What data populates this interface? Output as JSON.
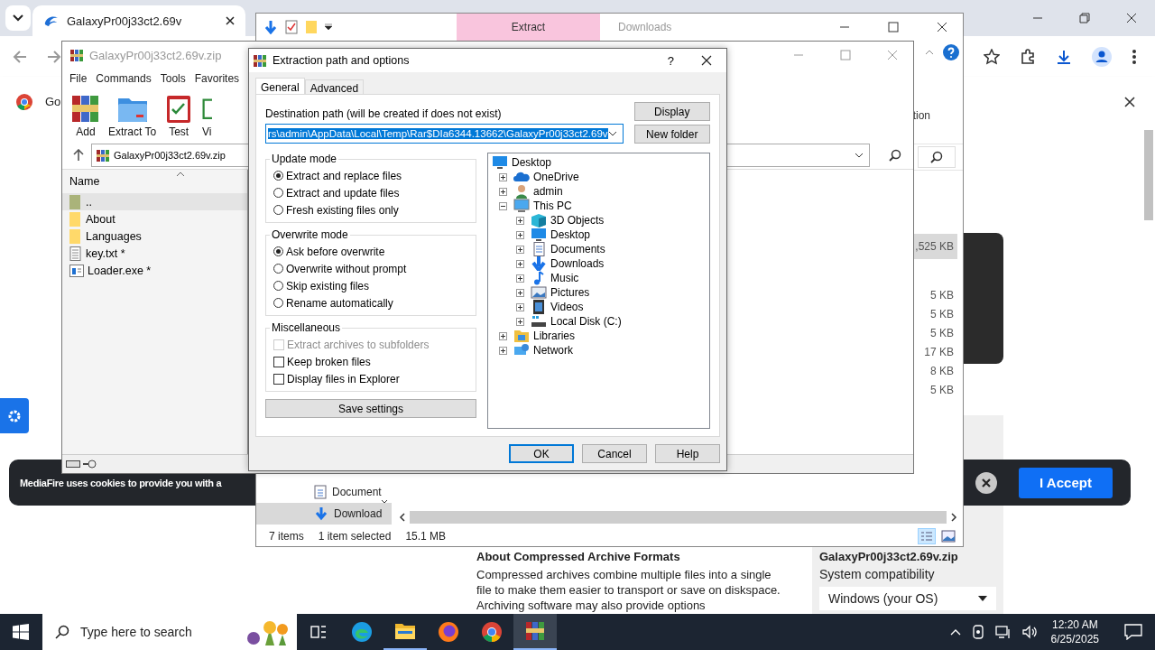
{
  "browser": {
    "tab_title": "GalaxyPr00j33ct2.69v",
    "bookmark_text": "Go"
  },
  "page": {
    "cookie_text": "MediaFire uses cookies to provide you with a",
    "accept_button": "I Accept",
    "heading": "About Compressed Archive Formats",
    "paragraph": "Compressed archives combine multiple files into a single file to make them easier to transport or save on diskspace. Archiving software may also provide options",
    "sidebar": {
      "file_name": "GalaxyPr00j33ct2.69v.zip",
      "label": "System compatibility",
      "os_select": "Windows (your OS)"
    }
  },
  "explorer": {
    "ribbon_tab": "Extract",
    "title": "Downloads",
    "ribbon_fragment": "tion",
    "sizes": [
      {
        "text": ",525 KB",
        "selected": true
      },
      {
        "text": "5 KB",
        "selected": false
      },
      {
        "text": "5 KB",
        "selected": false
      },
      {
        "text": "5 KB",
        "selected": false
      },
      {
        "text": "17 KB",
        "selected": false
      },
      {
        "text": "8 KB",
        "selected": false
      },
      {
        "text": "5 KB",
        "selected": false
      }
    ],
    "nav_items": [
      {
        "label": "Document",
        "kind": "documents",
        "selected": false
      },
      {
        "label": "Download",
        "kind": "downloads",
        "selected": true
      }
    ],
    "status_items": "7 items",
    "status_selected": "1 item selected",
    "status_size": "15.1 MB"
  },
  "winrar": {
    "title": "GalaxyPr00j33ct2.69v.zip",
    "menu": [
      "File",
      "Commands",
      "Tools",
      "Favorites"
    ],
    "toolbar": [
      {
        "label": "Add",
        "kind": "add"
      },
      {
        "label": "Extract To",
        "kind": "extract"
      },
      {
        "label": "Test",
        "kind": "test"
      },
      {
        "label": "Vi",
        "kind": "view"
      }
    ],
    "path": "GalaxyPr00j33ct2.69v.zip",
    "column": "Name",
    "files": [
      {
        "name": "..",
        "kind": "up",
        "selected": true
      },
      {
        "name": "About",
        "kind": "folder",
        "selected": false
      },
      {
        "name": "Languages",
        "kind": "folder",
        "selected": false
      },
      {
        "name": "key.txt *",
        "kind": "text",
        "selected": false
      },
      {
        "name": "Loader.exe *",
        "kind": "exe",
        "selected": false
      }
    ]
  },
  "dialog": {
    "title": "Extraction path and options",
    "help": "?",
    "tabs": [
      {
        "label": "General",
        "selected": true
      },
      {
        "label": "Advanced",
        "selected": false
      }
    ],
    "destination_label": "Destination path (will be created if does not exist)",
    "destination_path": "rs\\admin\\AppData\\Local\\Temp\\Rar$DIa6344.13662\\GalaxyPr00j33ct2.69v",
    "side_buttons": [
      "Display",
      "New folder"
    ],
    "groups": [
      {
        "title": "Update mode",
        "options": [
          {
            "label": "Extract and replace files",
            "kind": "radio",
            "checked": true,
            "disabled": false
          },
          {
            "label": "Extract and update files",
            "kind": "radio",
            "checked": false,
            "disabled": false
          },
          {
            "label": "Fresh existing files only",
            "kind": "radio",
            "checked": false,
            "disabled": false
          }
        ]
      },
      {
        "title": "Overwrite mode",
        "options": [
          {
            "label": "Ask before overwrite",
            "kind": "radio",
            "checked": true,
            "disabled": false
          },
          {
            "label": "Overwrite without prompt",
            "kind": "radio",
            "checked": false,
            "disabled": false
          },
          {
            "label": "Skip existing files",
            "kind": "radio",
            "checked": false,
            "disabled": false
          },
          {
            "label": "Rename automatically",
            "kind": "radio",
            "checked": false,
            "disabled": false
          }
        ]
      },
      {
        "title": "Miscellaneous",
        "options": [
          {
            "label": "Extract archives to subfolders",
            "kind": "checkbox",
            "checked": false,
            "disabled": true
          },
          {
            "label": "Keep broken files",
            "kind": "checkbox",
            "checked": false,
            "disabled": false
          },
          {
            "label": "Display files in Explorer",
            "kind": "checkbox",
            "checked": false,
            "disabled": false
          }
        ]
      }
    ],
    "save_button": "Save settings",
    "tree": {
      "label": "Desktop",
      "kind": "desktop",
      "children": [
        {
          "label": "OneDrive",
          "kind": "cloud",
          "expanded": false
        },
        {
          "label": "admin",
          "kind": "user",
          "expanded": false
        },
        {
          "label": "This PC",
          "kind": "pc",
          "expanded": true,
          "children": [
            {
              "label": "3D Objects",
              "kind": "cube",
              "expanded": false
            },
            {
              "label": "Desktop",
              "kind": "desktop",
              "expanded": false
            },
            {
              "label": "Documents",
              "kind": "document",
              "expanded": false
            },
            {
              "label": "Downloads",
              "kind": "download",
              "expanded": false
            },
            {
              "label": "Music",
              "kind": "music",
              "expanded": false
            },
            {
              "label": "Pictures",
              "kind": "pictures",
              "expanded": false
            },
            {
              "label": "Videos",
              "kind": "video",
              "expanded": false
            },
            {
              "label": "Local Disk (C:)",
              "kind": "disk",
              "expanded": false
            }
          ]
        },
        {
          "label": "Libraries",
          "kind": "libraries",
          "expanded": false
        },
        {
          "label": "Network",
          "kind": "network",
          "expanded": false
        }
      ]
    },
    "buttons": [
      {
        "label": "OK",
        "default": true
      },
      {
        "label": "Cancel",
        "default": false
      },
      {
        "label": "Help",
        "default": false
      }
    ]
  },
  "taskbar": {
    "search_placeholder": "Type here to search",
    "apps": [
      {
        "kind": "taskview",
        "active": false
      },
      {
        "kind": "edge",
        "active": false
      },
      {
        "kind": "explorer",
        "active": true
      },
      {
        "kind": "firefox",
        "active": false
      },
      {
        "kind": "chrome",
        "active": false
      },
      {
        "kind": "winrar",
        "active": true
      }
    ],
    "time": "12:20 AM",
    "date": "6/25/2025"
  }
}
